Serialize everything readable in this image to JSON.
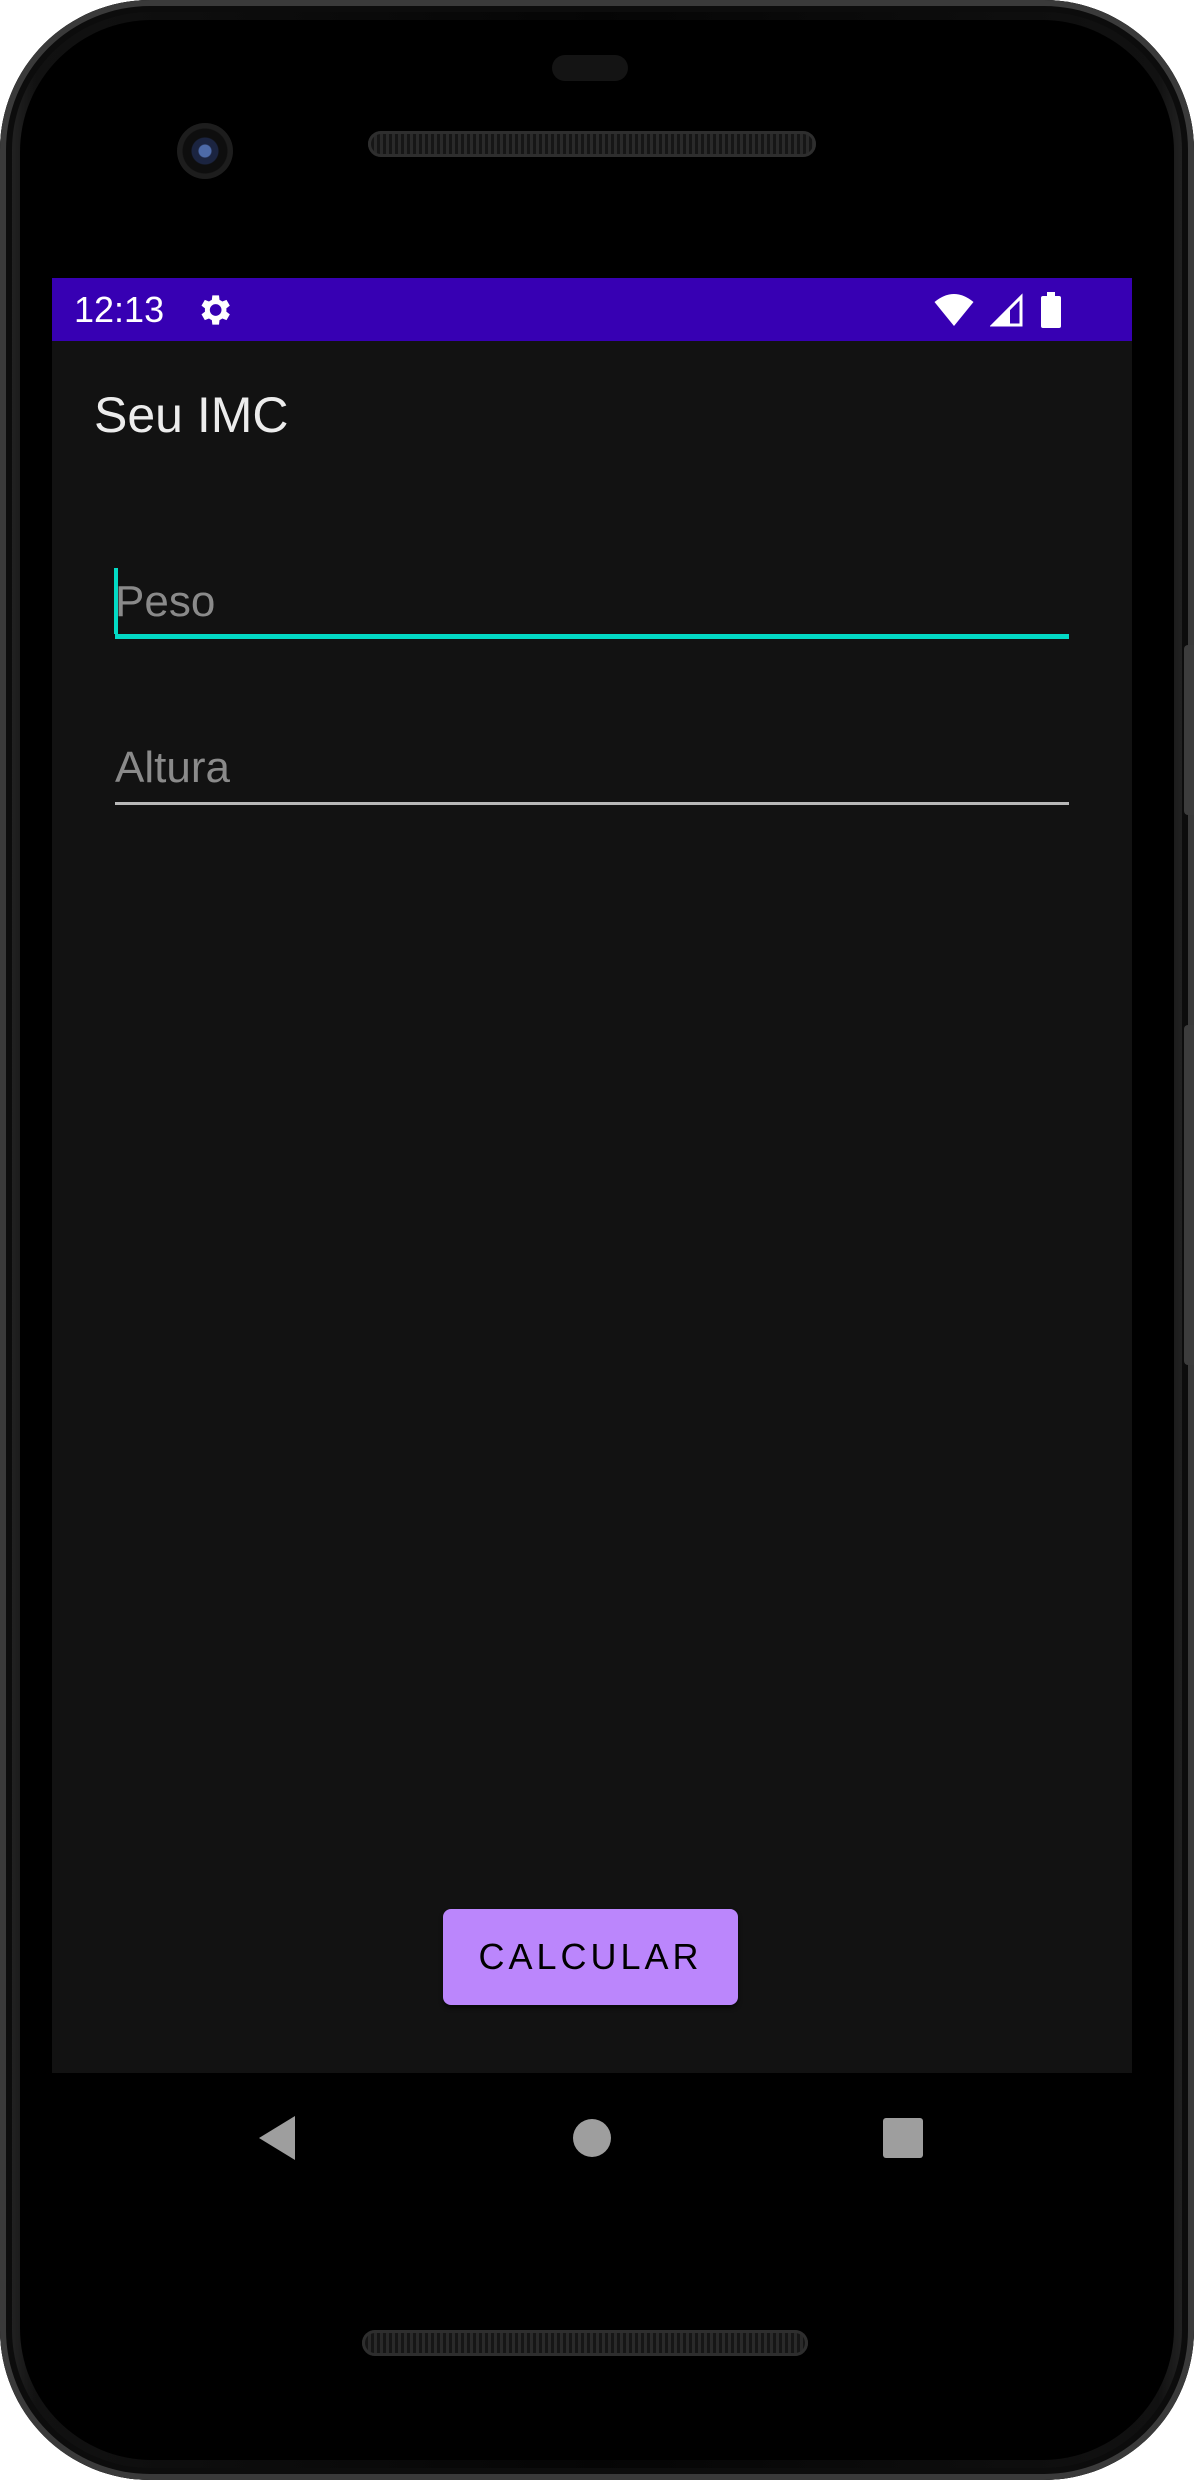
{
  "status_bar": {
    "time": "12:13",
    "background_color": "#3700b3",
    "settings_icon": "gear-icon",
    "wifi_icon": "wifi-icon",
    "signal_icon": "signal-icon",
    "battery_icon": "battery-icon"
  },
  "app_bar": {
    "title": "Seu IMC"
  },
  "form": {
    "weight": {
      "placeholder": "Peso",
      "value": "",
      "focused": true
    },
    "height": {
      "placeholder": "Altura",
      "value": ""
    },
    "accent_color": "#03dac5"
  },
  "actions": {
    "calculate_label": "CALCULAR",
    "button_color": "#bb86fc"
  },
  "navigation": {
    "back_icon": "back-triangle-icon",
    "home_icon": "home-circle-icon",
    "recents_icon": "recents-square-icon"
  },
  "theme": {
    "screen_background": "#121212"
  }
}
